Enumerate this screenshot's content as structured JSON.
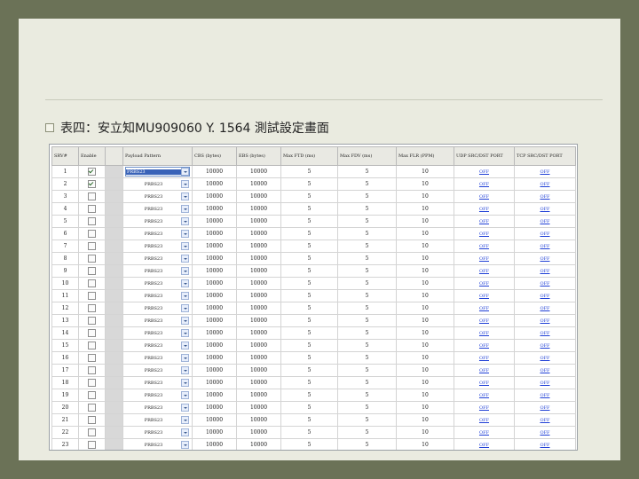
{
  "slide": {
    "caption": "表四：安立知MU909060 Y. 1564 測試設定畫面"
  },
  "table": {
    "headers": [
      "SRV#",
      "Enable",
      "",
      "Payload Pattern",
      "CBS (bytes)",
      "EBS (bytes)",
      "Max FTD (ms)",
      "Max FDV (ms)",
      "Max FLR (PPM)",
      "UDP SRC/DST PORT",
      "TCP SRC/DST PORT"
    ],
    "rows": [
      {
        "srv": "1",
        "enabled": true,
        "pattern": "PRBS23",
        "cbs": "10000",
        "ebs": "10000",
        "ftd": "5",
        "fdv": "5",
        "flr": "10",
        "udp": "OFF",
        "tcp": "OFF"
      },
      {
        "srv": "2",
        "enabled": true,
        "pattern": "PRBS23",
        "cbs": "10000",
        "ebs": "10000",
        "ftd": "5",
        "fdv": "5",
        "flr": "10",
        "udp": "OFF",
        "tcp": "OFF"
      },
      {
        "srv": "3",
        "enabled": false,
        "pattern": "PRBS23",
        "cbs": "10000",
        "ebs": "10000",
        "ftd": "5",
        "fdv": "5",
        "flr": "10",
        "udp": "OFF",
        "tcp": "OFF"
      },
      {
        "srv": "4",
        "enabled": false,
        "pattern": "PRBS23",
        "cbs": "10000",
        "ebs": "10000",
        "ftd": "5",
        "fdv": "5",
        "flr": "10",
        "udp": "OFF",
        "tcp": "OFF"
      },
      {
        "srv": "5",
        "enabled": false,
        "pattern": "PRBS23",
        "cbs": "10000",
        "ebs": "10000",
        "ftd": "5",
        "fdv": "5",
        "flr": "10",
        "udp": "OFF",
        "tcp": "OFF"
      },
      {
        "srv": "6",
        "enabled": false,
        "pattern": "PRBS23",
        "cbs": "10000",
        "ebs": "10000",
        "ftd": "5",
        "fdv": "5",
        "flr": "10",
        "udp": "OFF",
        "tcp": "OFF"
      },
      {
        "srv": "7",
        "enabled": false,
        "pattern": "PRBS23",
        "cbs": "10000",
        "ebs": "10000",
        "ftd": "5",
        "fdv": "5",
        "flr": "10",
        "udp": "OFF",
        "tcp": "OFF"
      },
      {
        "srv": "8",
        "enabled": false,
        "pattern": "PRBS23",
        "cbs": "10000",
        "ebs": "10000",
        "ftd": "5",
        "fdv": "5",
        "flr": "10",
        "udp": "OFF",
        "tcp": "OFF"
      },
      {
        "srv": "9",
        "enabled": false,
        "pattern": "PRBS23",
        "cbs": "10000",
        "ebs": "10000",
        "ftd": "5",
        "fdv": "5",
        "flr": "10",
        "udp": "OFF",
        "tcp": "OFF"
      },
      {
        "srv": "10",
        "enabled": false,
        "pattern": "PRBS23",
        "cbs": "10000",
        "ebs": "10000",
        "ftd": "5",
        "fdv": "5",
        "flr": "10",
        "udp": "OFF",
        "tcp": "OFF"
      },
      {
        "srv": "11",
        "enabled": false,
        "pattern": "PRBS23",
        "cbs": "10000",
        "ebs": "10000",
        "ftd": "5",
        "fdv": "5",
        "flr": "10",
        "udp": "OFF",
        "tcp": "OFF"
      },
      {
        "srv": "12",
        "enabled": false,
        "pattern": "PRBS23",
        "cbs": "10000",
        "ebs": "10000",
        "ftd": "5",
        "fdv": "5",
        "flr": "10",
        "udp": "OFF",
        "tcp": "OFF"
      },
      {
        "srv": "13",
        "enabled": false,
        "pattern": "PRBS23",
        "cbs": "10000",
        "ebs": "10000",
        "ftd": "5",
        "fdv": "5",
        "flr": "10",
        "udp": "OFF",
        "tcp": "OFF"
      },
      {
        "srv": "14",
        "enabled": false,
        "pattern": "PRBS23",
        "cbs": "10000",
        "ebs": "10000",
        "ftd": "5",
        "fdv": "5",
        "flr": "10",
        "udp": "OFF",
        "tcp": "OFF"
      },
      {
        "srv": "15",
        "enabled": false,
        "pattern": "PRBS23",
        "cbs": "10000",
        "ebs": "10000",
        "ftd": "5",
        "fdv": "5",
        "flr": "10",
        "udp": "OFF",
        "tcp": "OFF"
      },
      {
        "srv": "16",
        "enabled": false,
        "pattern": "PRBS23",
        "cbs": "10000",
        "ebs": "10000",
        "ftd": "5",
        "fdv": "5",
        "flr": "10",
        "udp": "OFF",
        "tcp": "OFF"
      },
      {
        "srv": "17",
        "enabled": false,
        "pattern": "PRBS23",
        "cbs": "10000",
        "ebs": "10000",
        "ftd": "5",
        "fdv": "5",
        "flr": "10",
        "udp": "OFF",
        "tcp": "OFF"
      },
      {
        "srv": "18",
        "enabled": false,
        "pattern": "PRBS23",
        "cbs": "10000",
        "ebs": "10000",
        "ftd": "5",
        "fdv": "5",
        "flr": "10",
        "udp": "OFF",
        "tcp": "OFF"
      },
      {
        "srv": "19",
        "enabled": false,
        "pattern": "PRBS23",
        "cbs": "10000",
        "ebs": "10000",
        "ftd": "5",
        "fdv": "5",
        "flr": "10",
        "udp": "OFF",
        "tcp": "OFF"
      },
      {
        "srv": "20",
        "enabled": false,
        "pattern": "PRBS23",
        "cbs": "10000",
        "ebs": "10000",
        "ftd": "5",
        "fdv": "5",
        "flr": "10",
        "udp": "OFF",
        "tcp": "OFF"
      },
      {
        "srv": "21",
        "enabled": false,
        "pattern": "PRBS23",
        "cbs": "10000",
        "ebs": "10000",
        "ftd": "5",
        "fdv": "5",
        "flr": "10",
        "udp": "OFF",
        "tcp": "OFF"
      },
      {
        "srv": "22",
        "enabled": false,
        "pattern": "PRBS23",
        "cbs": "10000",
        "ebs": "10000",
        "ftd": "5",
        "fdv": "5",
        "flr": "10",
        "udp": "OFF",
        "tcp": "OFF"
      },
      {
        "srv": "23",
        "enabled": false,
        "pattern": "PRBS23",
        "cbs": "10000",
        "ebs": "10000",
        "ftd": "5",
        "fdv": "5",
        "flr": "10",
        "udp": "OFF",
        "tcp": "OFF"
      }
    ]
  }
}
